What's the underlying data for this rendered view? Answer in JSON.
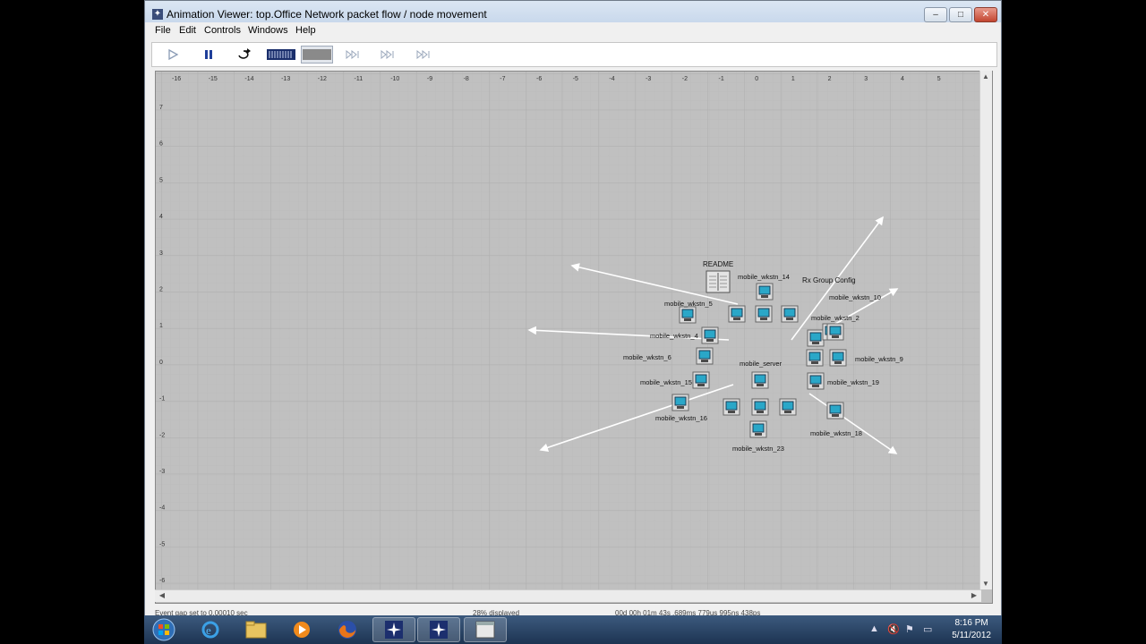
{
  "window": {
    "title": "Animation Viewer: top.Office Network packet flow / node movement",
    "controls": {
      "minimize": "–",
      "maximize": "□",
      "close": "✕"
    }
  },
  "menu": [
    "File",
    "Edit",
    "Controls",
    "Windows",
    "Help"
  ],
  "toolbar": {
    "icons": [
      "play-icon",
      "pause-icon",
      "replay-icon",
      "speed-slow-icon",
      "speed-fast-icon",
      "step-forward-icon",
      "step-forward-icon",
      "step-forward-icon"
    ]
  },
  "canvas": {
    "x_ticks": [
      "-16",
      "-15",
      "-14",
      "-13",
      "-12",
      "-11",
      "-10",
      "-9",
      "-8",
      "-7",
      "-6",
      "-5",
      "-4",
      "-3",
      "-2",
      "-1",
      "0",
      "1",
      "2",
      "3",
      "4",
      "5"
    ],
    "y_ticks": [
      "7",
      "6",
      "5",
      "4",
      "3",
      "2",
      "1",
      "0",
      "-1",
      "-2",
      "-3",
      "-4",
      "-5",
      "-6"
    ],
    "readme_label": "README",
    "config_label": "Rx Group Config",
    "nodes": [
      {
        "label": "mobile_wkstn_14"
      },
      {
        "label": "mobile_wkstn_5"
      },
      {
        "label": "mobile_wkstn_10"
      },
      {
        "label": "mobile_wkstn_2"
      },
      {
        "label": "mobile_wkstn_4"
      },
      {
        "label": "mobile_wkstn_6"
      },
      {
        "label": "mobile_server"
      },
      {
        "label": "mobile_wkstn_9"
      },
      {
        "label": "mobile_wkstn_15"
      },
      {
        "label": "mobile_wkstn_19"
      },
      {
        "label": "mobile_wkstn_16"
      },
      {
        "label": "mobile_wkstn_18"
      },
      {
        "label": "mobile_wkstn_23"
      }
    ]
  },
  "status": {
    "event": "Event gap set to 0.00010 sec",
    "displayed": "28% displayed",
    "time": "00d 00h 01m 43s .689ms 779us 995ns 438ps"
  },
  "taskbar": {
    "apps": [
      "windows-start-icon",
      "internet-explorer-icon",
      "folder-icon",
      "media-player-icon",
      "firefox-icon",
      "app-star-icon",
      "app-star-icon",
      "window-icon"
    ],
    "time": "8:16 PM",
    "date": "5/11/2012"
  }
}
